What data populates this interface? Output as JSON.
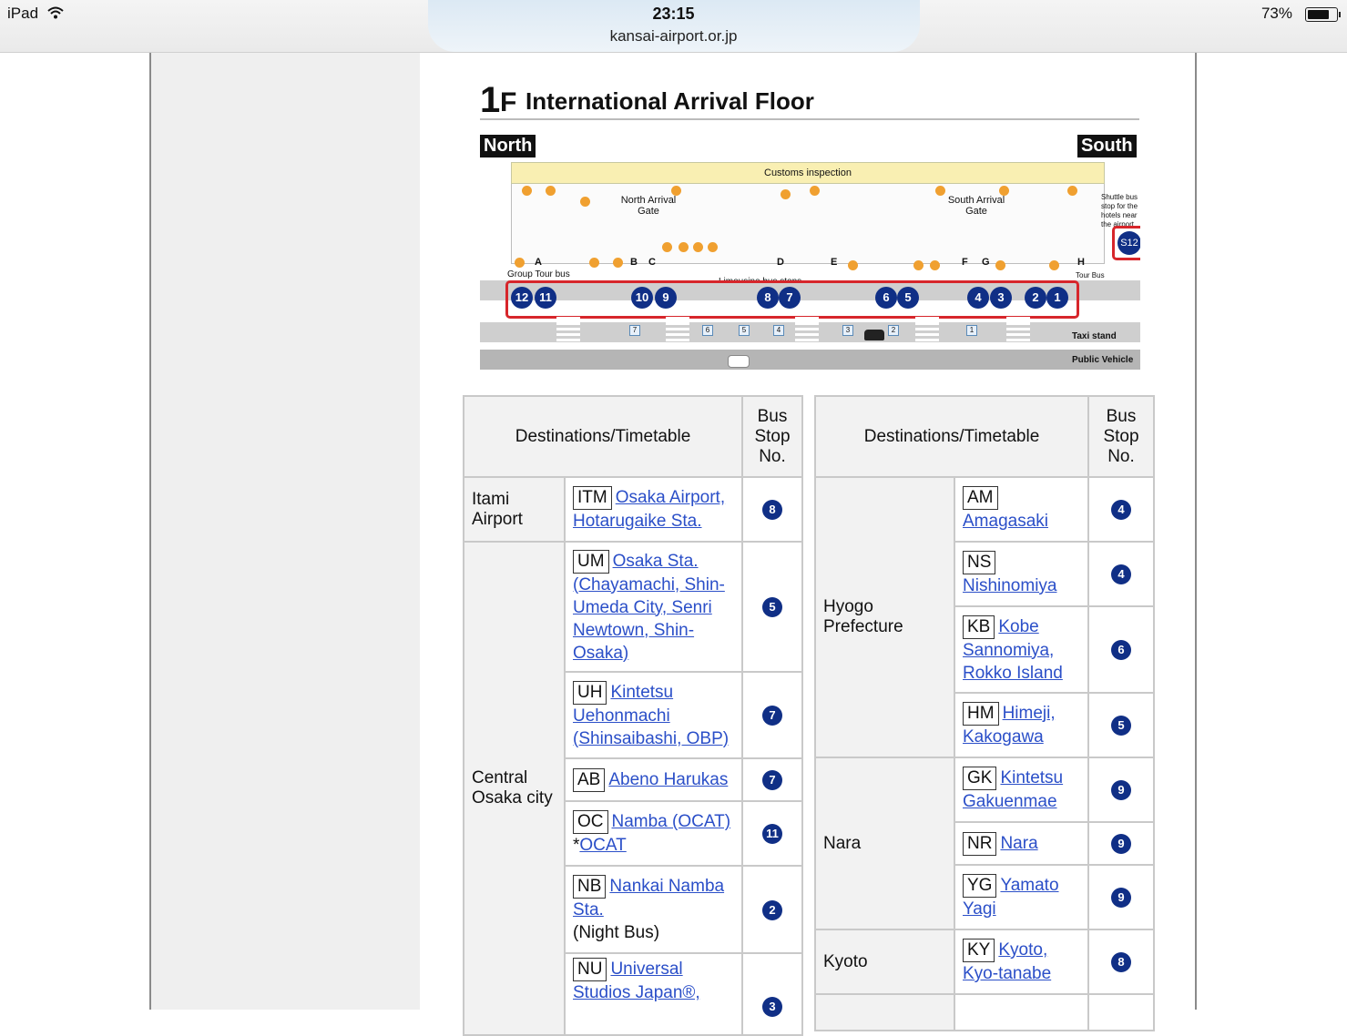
{
  "status_bar": {
    "device": "iPad",
    "time": "23:15",
    "url": "kansai-airport.or.jp",
    "battery": "73%"
  },
  "map": {
    "floor_number": "1",
    "floor_letter": "F",
    "title": "International Arrival Floor",
    "north": "North",
    "south": "South",
    "customs": "Customs inspection",
    "north_gate": "North Arrival Gate",
    "south_gate": "South Arrival Gate",
    "letters": [
      "A",
      "B",
      "C",
      "D",
      "E",
      "F",
      "G",
      "H"
    ],
    "bus_stops": [
      "12",
      "11",
      "10",
      "9",
      "8",
      "7",
      "6",
      "5",
      "4",
      "3",
      "2",
      "1"
    ],
    "s12": "S12",
    "shuttle_note": "Shuttle bus stop for the hotels near the airport",
    "limousine": "Limousine bus stops",
    "group_tour": "Group Tour bus",
    "tour_south": "Tour Bus (South)",
    "taxi": "Taxi stand",
    "public": "Public Vehicle",
    "lower_stops": [
      "7",
      "6",
      "5",
      "4",
      "3",
      "2",
      "1"
    ]
  },
  "left_table": {
    "header_dest": "Destinations/Timetable",
    "header_stop": "Bus Stop No.",
    "rows": [
      {
        "area": "Itami Airport",
        "code": "ITM",
        "link": "Osaka Airport, Hotarugaike Sta.",
        "stop": "8"
      },
      {
        "area": "Central Osaka city",
        "code": "UM",
        "link": "Osaka Sta. (Chayamachi, Shin-Umeda City, Senri Newtown, Shin-Osaka)",
        "stop": "5"
      },
      {
        "code": "UH",
        "link": "Kintetsu Uehonmachi (Shinsaibashi, OBP)",
        "stop": "7"
      },
      {
        "code": "AB",
        "link": "Abeno Harukas",
        "stop": "7"
      },
      {
        "code": "OC",
        "link": "Namba (OCAT)",
        "extra_prefix": "*",
        "extra_link": "OCAT",
        "stop": "11"
      },
      {
        "code": "NB",
        "link": "Nankai Namba Sta.",
        "note": "(Night Bus)",
        "stop": "2"
      },
      {
        "code": "NU",
        "link": "Universal Studios Japan®,",
        "stop": "3"
      }
    ]
  },
  "right_table": {
    "header_dest": "Destinations/Timetable",
    "header_stop": "Bus Stop No.",
    "rows": [
      {
        "area": "Hyogo Prefecture",
        "code": "AM",
        "link": "Amagasaki",
        "stop": "4"
      },
      {
        "code": "NS",
        "link": "Nishinomiya",
        "stop": "4"
      },
      {
        "code": "KB",
        "link": "Kobe Sannomiya, Rokko Island",
        "stop": "6"
      },
      {
        "code": "HM",
        "link": "Himeji, Kakogawa",
        "stop": "5"
      },
      {
        "area": "Nara",
        "code": "GK",
        "link": "Kintetsu Gakuenmae",
        "stop": "9"
      },
      {
        "code": "NR",
        "link": "Nara",
        "stop": "9"
      },
      {
        "code": "YG",
        "link": "Yamato Yagi",
        "stop": "9"
      },
      {
        "area": "Kyoto",
        "code": "KY",
        "link": "Kyoto, Kyo-tanabe",
        "stop": "8"
      }
    ]
  }
}
